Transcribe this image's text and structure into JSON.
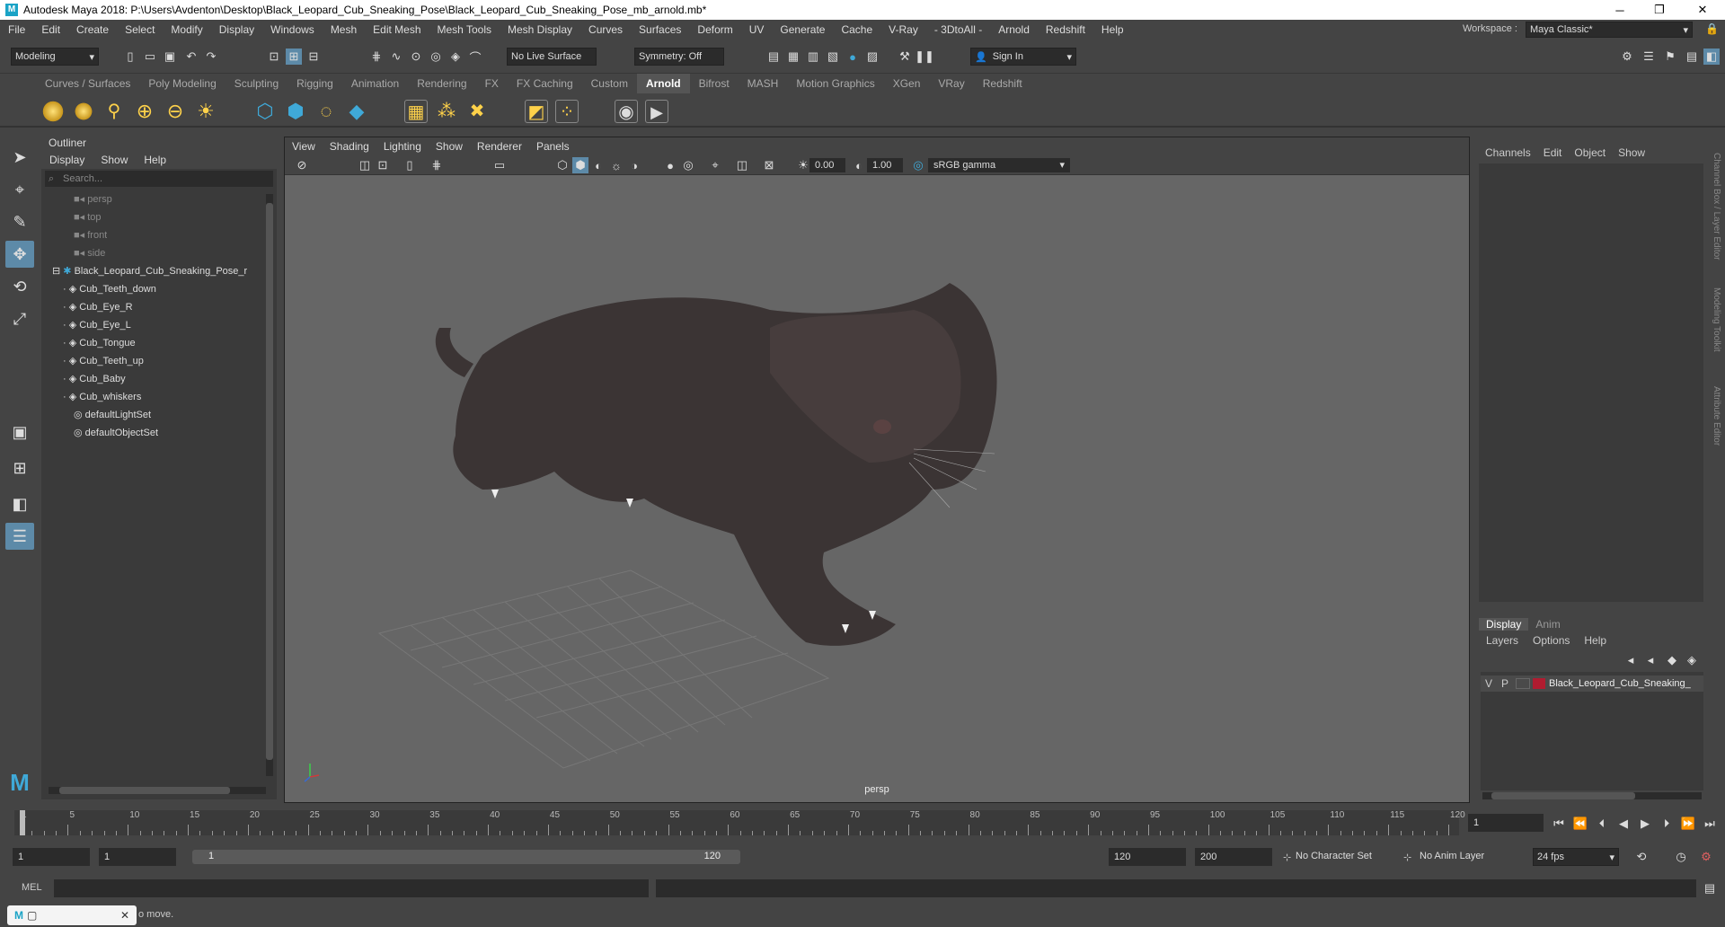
{
  "window": {
    "title": "Autodesk Maya 2018: P:\\Users\\Avdenton\\Desktop\\Black_Leopard_Cub_Sneaking_Pose\\Black_Leopard_Cub_Sneaking_Pose_mb_arnold.mb*",
    "logo_letter": "M",
    "controls": [
      "─",
      "❐",
      "✕"
    ]
  },
  "menubar": {
    "items": [
      "File",
      "Edit",
      "Create",
      "Select",
      "Modify",
      "Display",
      "Windows",
      "Mesh",
      "Edit Mesh",
      "Mesh Tools",
      "Mesh Display",
      "Curves",
      "Surfaces",
      "Deform",
      "UV",
      "Generate",
      "Cache",
      "V-Ray",
      "- 3DtoAll -",
      "Arnold",
      "Redshift",
      "Help"
    ],
    "workspace_label": "Workspace :",
    "workspace_value": "Maya Classic*"
  },
  "statusline": {
    "mode": "Modeling",
    "live_surface": "No Live Surface",
    "symmetry": "Symmetry: Off",
    "sign_in": "Sign In"
  },
  "shelf": {
    "tabs": [
      "Curves / Surfaces",
      "Poly Modeling",
      "Sculpting",
      "Rigging",
      "Animation",
      "Rendering",
      "FX",
      "FX Caching",
      "Custom",
      "Arnold",
      "Bifrost",
      "MASH",
      "Motion Graphics",
      "XGen",
      "VRay",
      "Redshift"
    ],
    "active_tab": "Arnold"
  },
  "outliner": {
    "title": "Outliner",
    "menu": [
      "Display",
      "Show",
      "Help"
    ],
    "search_placeholder": "Search...",
    "items": [
      {
        "label": "persp",
        "kind": "camera",
        "indent": 1
      },
      {
        "label": "top",
        "kind": "camera",
        "indent": 1
      },
      {
        "label": "front",
        "kind": "camera",
        "indent": 1
      },
      {
        "label": "side",
        "kind": "camera",
        "indent": 1
      },
      {
        "label": "Black_Leopard_Cub_Sneaking_Pose_r",
        "kind": "group",
        "indent": 0
      },
      {
        "label": "Cub_Teeth_down",
        "kind": "mesh",
        "indent": 2
      },
      {
        "label": "Cub_Eye_R",
        "kind": "mesh",
        "indent": 2
      },
      {
        "label": "Cub_Eye_L",
        "kind": "mesh",
        "indent": 2
      },
      {
        "label": "Cub_Tongue",
        "kind": "mesh",
        "indent": 2
      },
      {
        "label": "Cub_Teeth_up",
        "kind": "mesh",
        "indent": 2
      },
      {
        "label": "Cub_Baby",
        "kind": "mesh",
        "indent": 2
      },
      {
        "label": "Cub_whiskers",
        "kind": "mesh",
        "indent": 2
      },
      {
        "label": "defaultLightSet",
        "kind": "set",
        "indent": 1
      },
      {
        "label": "defaultObjectSet",
        "kind": "set",
        "indent": 1
      }
    ]
  },
  "viewport": {
    "menu": [
      "View",
      "Shading",
      "Lighting",
      "Show",
      "Renderer",
      "Panels"
    ],
    "exposure": "0.00",
    "gamma": "1.00",
    "color_space": "sRGB gamma",
    "camera_label": "persp"
  },
  "channelbox": {
    "menu": [
      "Channels",
      "Edit",
      "Object",
      "Show"
    ],
    "side_tabs": [
      "Channel Box / Layer Editor",
      "Modeling Toolkit",
      "Attribute Editor"
    ]
  },
  "layers": {
    "tabs": [
      "Display",
      "Anim"
    ],
    "menu": [
      "Layers",
      "Options",
      "Help"
    ],
    "layer": {
      "v": "V",
      "p": "P",
      "name": "Black_Leopard_Cub_Sneaking_",
      "color": "#b01c30"
    }
  },
  "timeline": {
    "ticks": [
      "1",
      "5",
      "10",
      "15",
      "20",
      "25",
      "30",
      "35",
      "40",
      "45",
      "50",
      "55",
      "60",
      "65",
      "70",
      "75",
      "80",
      "85",
      "90",
      "95",
      "100",
      "105",
      "110",
      "115",
      "120"
    ],
    "current_frame": "1"
  },
  "range": {
    "start": "1",
    "start_inner": "1",
    "slider_start": "1",
    "slider_end": "120",
    "end_inner": "120",
    "end": "200",
    "character_set": "No Character Set",
    "anim_layer": "No Anim Layer",
    "fps": "24 fps"
  },
  "cmdline": {
    "label": "MEL"
  },
  "helpline": {
    "text": "o move."
  },
  "colors": {
    "accent": "#5d8aa8",
    "ui_bg": "#444444",
    "viewport_bg": "#666666",
    "layer_color": "#b01c30"
  }
}
